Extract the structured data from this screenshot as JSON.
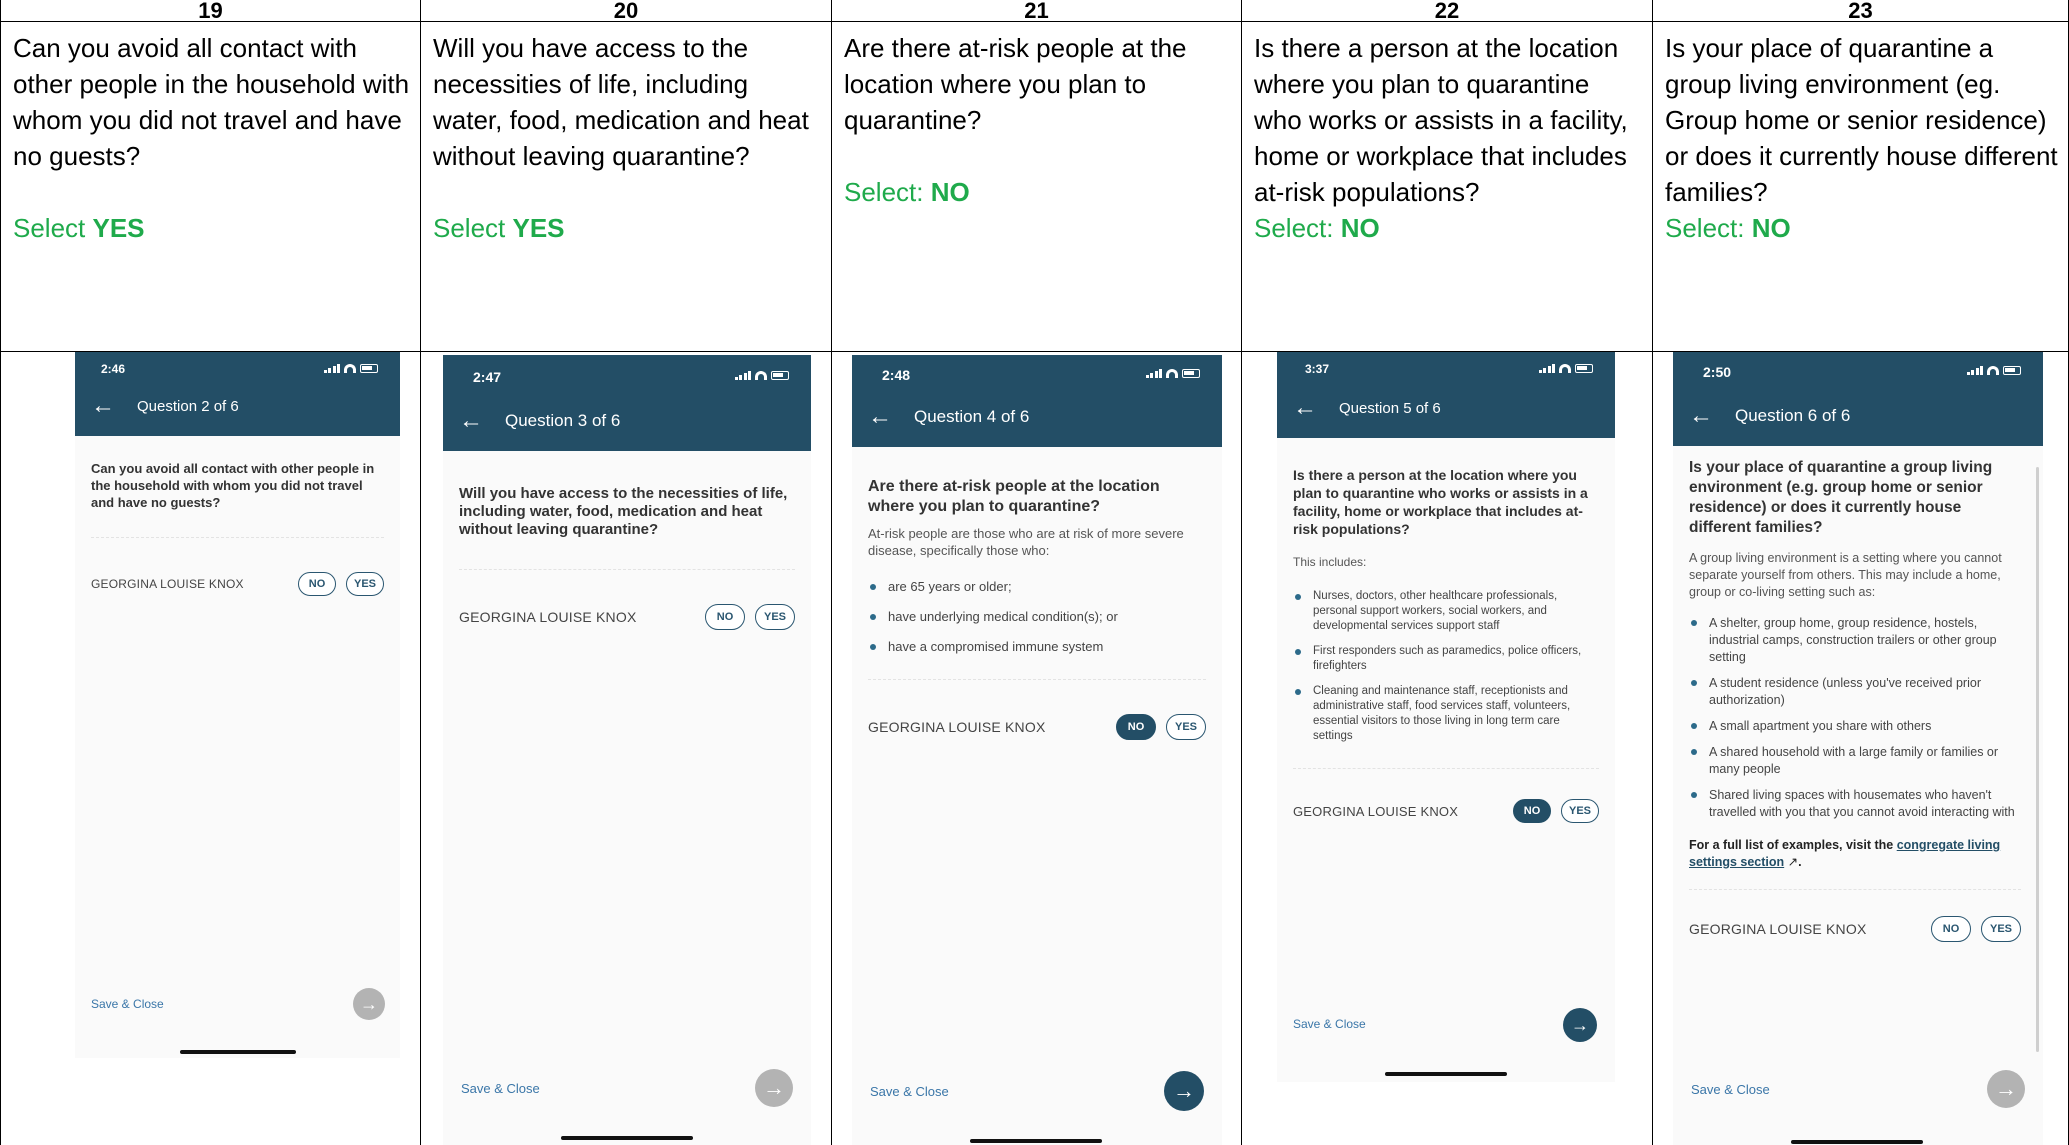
{
  "columns": [
    {
      "number": "19",
      "question": "Can you avoid all contact with other people in the household with whom you did not travel and have no guests?",
      "select_prefix": "Select",
      "select_value": "YES",
      "phone": {
        "time": "2:46",
        "question_count": "Question 2 of 6",
        "title": "Can you avoid all contact with other people in the household with whom you did not travel and have no guests?",
        "person": "GEORGINA LOUISE KNOX",
        "no_label": "NO",
        "yes_label": "YES",
        "selected": "none",
        "save_label": "Save & Close",
        "next_enabled": false
      }
    },
    {
      "number": "20",
      "question": "Will you have access to the necessities of life, including water, food, medication and heat without leaving quarantine?",
      "select_prefix": "Select",
      "select_value": "YES",
      "phone": {
        "time": "2:47",
        "question_count": "Question 3 of 6",
        "title": "Will you have access to the necessities of life, including water, food, medication and heat without leaving quarantine?",
        "person": "GEORGINA LOUISE KNOX",
        "no_label": "NO",
        "yes_label": "YES",
        "selected": "none",
        "save_label": "Save & Close",
        "next_enabled": false
      }
    },
    {
      "number": "21",
      "question": "Are there at-risk people at the location where you plan to quarantine?",
      "select_prefix": "Select:",
      "select_value": "NO",
      "phone": {
        "time": "2:48",
        "question_count": "Question 4 of 6",
        "title": "Are there at-risk people at the location where you plan to quarantine?",
        "info": "At-risk people are those who are at risk of more severe disease, specifically those who:",
        "bullets": [
          "are 65 years or older;",
          "have underlying medical condition(s); or",
          "have a compromised immune system"
        ],
        "person": "GEORGINA LOUISE KNOX",
        "no_label": "NO",
        "yes_label": "YES",
        "selected": "no",
        "save_label": "Save & Close",
        "next_enabled": true
      }
    },
    {
      "number": "22",
      "question": "Is there a person at the location where you plan to quarantine who works or assists in a facility, home or workplace that includes at-risk populations?",
      "select_prefix": "Select:",
      "select_value": "NO",
      "phone": {
        "time": "3:37",
        "question_count": "Question 5 of 6",
        "title": "Is there a person at the location where you plan to quarantine who works or assists in a facility, home or workplace that includes at-risk populations?",
        "info": "This includes:",
        "bullets": [
          "Nurses, doctors, other healthcare professionals, personal support workers, social workers, and developmental services support staff",
          "First responders such as paramedics, police officers, firefighters",
          "Cleaning and maintenance staff, receptionists and administrative staff, food services staff, volunteers, essential visitors to those living in long term care settings"
        ],
        "person": "GEORGINA LOUISE KNOX",
        "no_label": "NO",
        "yes_label": "YES",
        "selected": "no",
        "save_label": "Save & Close",
        "next_enabled": true
      }
    },
    {
      "number": "23",
      "question": "Is your place of quarantine a group living environment (eg. Group home or senior residence) or does it currently house different families?",
      "select_prefix": "Select:",
      "select_value": "NO",
      "phone": {
        "time": "2:50",
        "question_count": "Question 6 of 6",
        "title": "Is your place of quarantine a group living environment (e.g. group home or senior residence) or does it currently house different families?",
        "info": "A group living environment is a setting where you cannot separate yourself from others. This may include a home, group or co-living setting such as:",
        "bullets": [
          "A shelter, group home, group residence, hostels, industrial camps, construction trailers or other group setting",
          "A student residence (unless you've received prior authorization)",
          "A small apartment you share with others",
          "A shared household with a large family or families or many people",
          "Shared living spaces with housemates who haven't travelled with you that you cannot avoid interacting with"
        ],
        "footnote_prefix": "For a full list of examples, visit the",
        "footnote_link": "congregate living settings section",
        "footnote_suffix": ".",
        "person": "GEORGINA LOUISE KNOX",
        "no_label": "NO",
        "yes_label": "YES",
        "selected": "none",
        "save_label": "Save & Close",
        "next_enabled": false
      }
    }
  ],
  "icons": {
    "back": "arrow-left-icon",
    "next": "arrow-right-icon",
    "external": "external-link-icon"
  },
  "colors": {
    "appbar": "#234e66",
    "select_green": "#1faa4b",
    "fab_disabled": "#b3b3b3"
  }
}
